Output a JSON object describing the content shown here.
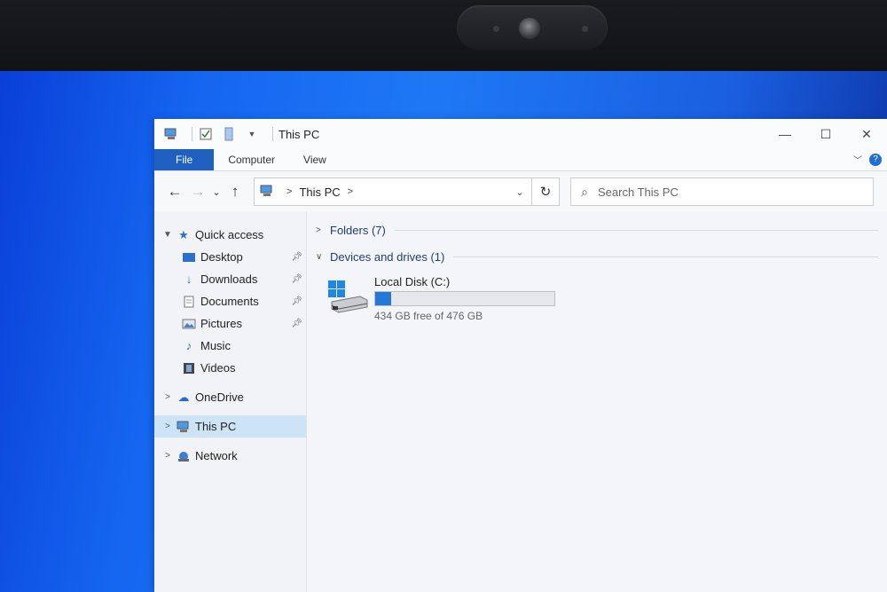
{
  "window": {
    "title": "This PC"
  },
  "ribbon": {
    "tabs": [
      "File",
      "Computer",
      "View"
    ]
  },
  "address": {
    "path": "This PC"
  },
  "search": {
    "placeholder": "Search This PC"
  },
  "nav": {
    "quick_access": "Quick access",
    "quick_items": [
      "Desktop",
      "Downloads",
      "Documents",
      "Pictures",
      "Music",
      "Videos"
    ],
    "onedrive": "OneDrive",
    "this_pc": "This PC",
    "network": "Network"
  },
  "content": {
    "folders_group": "Folders (7)",
    "devices_group": "Devices and drives (1)",
    "drive": {
      "name": "Local Disk (C:)",
      "free_text": "434 GB free of 476 GB",
      "used_fraction": 0.088
    }
  },
  "colors": {
    "accent": "#1f5fbf",
    "bar_fill": "#2678d6",
    "selection": "#cde4f7"
  }
}
